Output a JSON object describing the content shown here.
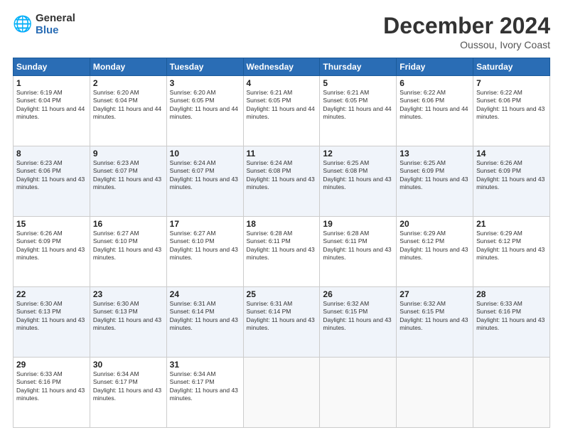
{
  "logo": {
    "general": "General",
    "blue": "Blue"
  },
  "header": {
    "title": "December 2024",
    "location": "Oussou, Ivory Coast"
  },
  "days_of_week": [
    "Sunday",
    "Monday",
    "Tuesday",
    "Wednesday",
    "Thursday",
    "Friday",
    "Saturday"
  ],
  "weeks": [
    [
      {
        "day": "1",
        "sunrise": "6:19 AM",
        "sunset": "6:04 PM",
        "daylight": "11 hours and 44 minutes."
      },
      {
        "day": "2",
        "sunrise": "6:20 AM",
        "sunset": "6:04 PM",
        "daylight": "11 hours and 44 minutes."
      },
      {
        "day": "3",
        "sunrise": "6:20 AM",
        "sunset": "6:05 PM",
        "daylight": "11 hours and 44 minutes."
      },
      {
        "day": "4",
        "sunrise": "6:21 AM",
        "sunset": "6:05 PM",
        "daylight": "11 hours and 44 minutes."
      },
      {
        "day": "5",
        "sunrise": "6:21 AM",
        "sunset": "6:05 PM",
        "daylight": "11 hours and 44 minutes."
      },
      {
        "day": "6",
        "sunrise": "6:22 AM",
        "sunset": "6:06 PM",
        "daylight": "11 hours and 44 minutes."
      },
      {
        "day": "7",
        "sunrise": "6:22 AM",
        "sunset": "6:06 PM",
        "daylight": "11 hours and 43 minutes."
      }
    ],
    [
      {
        "day": "8",
        "sunrise": "6:23 AM",
        "sunset": "6:06 PM",
        "daylight": "11 hours and 43 minutes."
      },
      {
        "day": "9",
        "sunrise": "6:23 AM",
        "sunset": "6:07 PM",
        "daylight": "11 hours and 43 minutes."
      },
      {
        "day": "10",
        "sunrise": "6:24 AM",
        "sunset": "6:07 PM",
        "daylight": "11 hours and 43 minutes."
      },
      {
        "day": "11",
        "sunrise": "6:24 AM",
        "sunset": "6:08 PM",
        "daylight": "11 hours and 43 minutes."
      },
      {
        "day": "12",
        "sunrise": "6:25 AM",
        "sunset": "6:08 PM",
        "daylight": "11 hours and 43 minutes."
      },
      {
        "day": "13",
        "sunrise": "6:25 AM",
        "sunset": "6:09 PM",
        "daylight": "11 hours and 43 minutes."
      },
      {
        "day": "14",
        "sunrise": "6:26 AM",
        "sunset": "6:09 PM",
        "daylight": "11 hours and 43 minutes."
      }
    ],
    [
      {
        "day": "15",
        "sunrise": "6:26 AM",
        "sunset": "6:09 PM",
        "daylight": "11 hours and 43 minutes."
      },
      {
        "day": "16",
        "sunrise": "6:27 AM",
        "sunset": "6:10 PM",
        "daylight": "11 hours and 43 minutes."
      },
      {
        "day": "17",
        "sunrise": "6:27 AM",
        "sunset": "6:10 PM",
        "daylight": "11 hours and 43 minutes."
      },
      {
        "day": "18",
        "sunrise": "6:28 AM",
        "sunset": "6:11 PM",
        "daylight": "11 hours and 43 minutes."
      },
      {
        "day": "19",
        "sunrise": "6:28 AM",
        "sunset": "6:11 PM",
        "daylight": "11 hours and 43 minutes."
      },
      {
        "day": "20",
        "sunrise": "6:29 AM",
        "sunset": "6:12 PM",
        "daylight": "11 hours and 43 minutes."
      },
      {
        "day": "21",
        "sunrise": "6:29 AM",
        "sunset": "6:12 PM",
        "daylight": "11 hours and 43 minutes."
      }
    ],
    [
      {
        "day": "22",
        "sunrise": "6:30 AM",
        "sunset": "6:13 PM",
        "daylight": "11 hours and 43 minutes."
      },
      {
        "day": "23",
        "sunrise": "6:30 AM",
        "sunset": "6:13 PM",
        "daylight": "11 hours and 43 minutes."
      },
      {
        "day": "24",
        "sunrise": "6:31 AM",
        "sunset": "6:14 PM",
        "daylight": "11 hours and 43 minutes."
      },
      {
        "day": "25",
        "sunrise": "6:31 AM",
        "sunset": "6:14 PM",
        "daylight": "11 hours and 43 minutes."
      },
      {
        "day": "26",
        "sunrise": "6:32 AM",
        "sunset": "6:15 PM",
        "daylight": "11 hours and 43 minutes."
      },
      {
        "day": "27",
        "sunrise": "6:32 AM",
        "sunset": "6:15 PM",
        "daylight": "11 hours and 43 minutes."
      },
      {
        "day": "28",
        "sunrise": "6:33 AM",
        "sunset": "6:16 PM",
        "daylight": "11 hours and 43 minutes."
      }
    ],
    [
      {
        "day": "29",
        "sunrise": "6:33 AM",
        "sunset": "6:16 PM",
        "daylight": "11 hours and 43 minutes."
      },
      {
        "day": "30",
        "sunrise": "6:34 AM",
        "sunset": "6:17 PM",
        "daylight": "11 hours and 43 minutes."
      },
      {
        "day": "31",
        "sunrise": "6:34 AM",
        "sunset": "6:17 PM",
        "daylight": "11 hours and 43 minutes."
      },
      null,
      null,
      null,
      null
    ]
  ]
}
